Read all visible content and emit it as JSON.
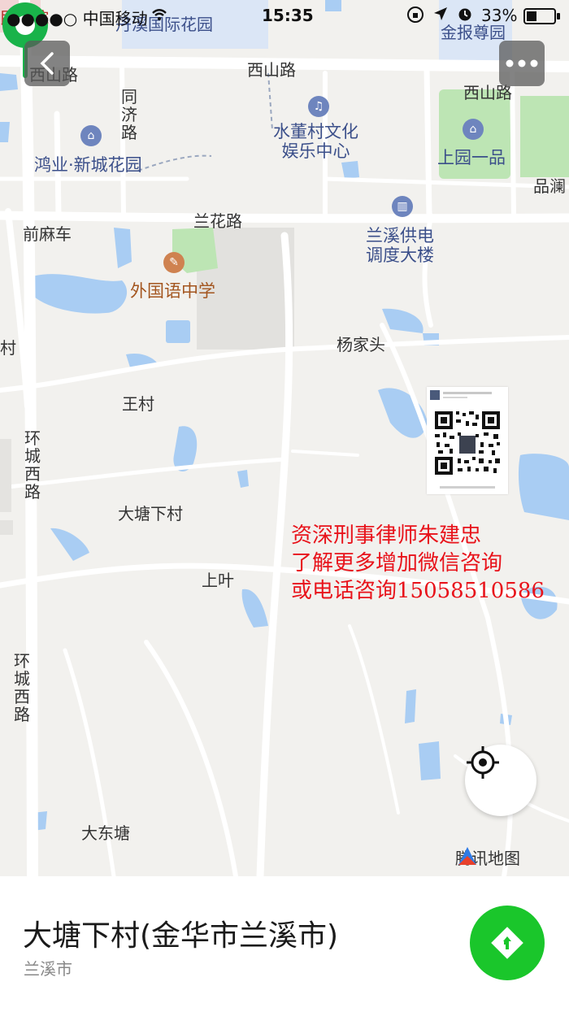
{
  "status_bar": {
    "carrier": "●●●●○ 中国移动",
    "time": "15:35",
    "battery": "33%"
  },
  "map": {
    "labels": {
      "ximing_road_left": "西山路",
      "ximing_road_mid": "西山路",
      "ximing_road_right": "西山路",
      "tongji_road": "同济路",
      "lanhua_road": "兰花路",
      "qianmache": "前麻车",
      "yangjiatou": "杨家头",
      "wangcun": "王村",
      "datangxiacun": "大塘下村",
      "shangye": "上叶",
      "dadongtang": "大东塘",
      "huancheng_west_1": "环城西路",
      "huancheng_west_2": "环城西路",
      "cun_edge": "村",
      "pinlan": "品澜",
      "top_left_cut": "民医院",
      "top_partial": "丹溪国际花园",
      "jinbao": "金报尊园"
    },
    "pois": {
      "hongye": "鸿业·新城花园",
      "shuidong": "水董村文化\n娱乐中心",
      "shangyuan": "上园一品",
      "lanxi_power": "兰溪供电\n调度大楼",
      "foreign_school": "外国语中学"
    },
    "overlay_text": {
      "line1": "资深刑事律师朱建忠",
      "line2": "了解更多增加微信咨询",
      "line3": "或电话咨询15058510586"
    },
    "brand": "腾讯地图"
  },
  "place": {
    "title": "大塘下村(金华市兰溪市)",
    "subtitle": "兰溪市"
  },
  "colors": {
    "pin_green": "#19b34a",
    "route_green": "#1ac62b",
    "water": "#a9cdf3",
    "park": "#bde5b4",
    "overlay_red": "#e8131b"
  },
  "icons": {
    "back": "back-chevron-icon",
    "more": "more-dots-icon",
    "locate": "locate-crosshair-icon",
    "route": "route-direction-icon"
  }
}
